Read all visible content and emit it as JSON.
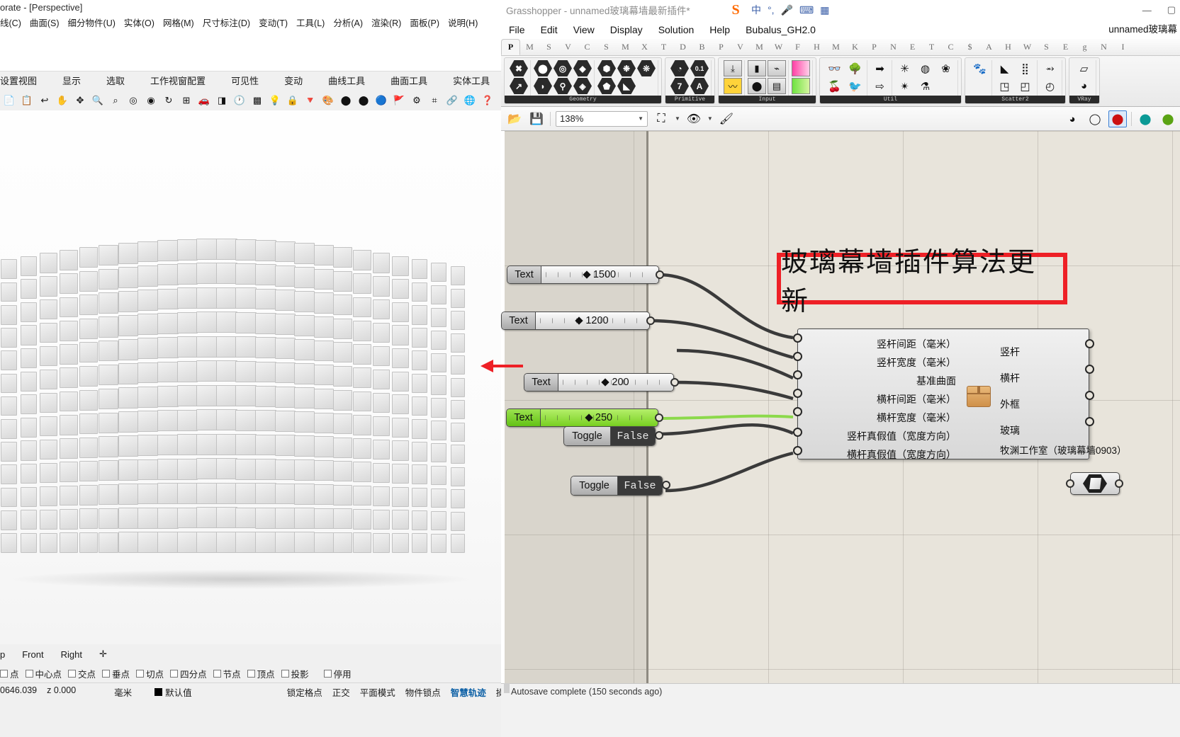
{
  "rhino": {
    "title": "orate - [Perspective]",
    "menus": [
      "线(C)",
      "曲面(S)",
      "细分物件(U)",
      "实体(O)",
      "网格(M)",
      "尺寸标注(D)",
      "变动(T)",
      "工具(L)",
      "分析(A)",
      "渲染(R)",
      "面板(P)",
      "说明(H)"
    ],
    "toolbar_tabs": [
      "设置视图",
      "显示",
      "选取",
      "工作视窗配置",
      "可见性",
      "变动",
      "曲线工具",
      "曲面工具",
      "实体工具"
    ],
    "icon_names": [
      "copy-icon",
      "paste-icon",
      "undo-icon",
      "pan-icon",
      "move-icon",
      "zoom-in-icon",
      "zoom-window-icon",
      "zoom-extents-icon",
      "zoom-selected-icon",
      "rotate-view-icon",
      "viewport-layout-icon",
      "car-icon",
      "shade-icon",
      "clock-icon",
      "properties-icon",
      "light-icon",
      "lock-icon",
      "color-icon",
      "colorwheel-icon",
      "sphere-grey-icon",
      "sphere-dark-icon",
      "sphere-blue-icon",
      "flag-icon",
      "gear-icon",
      "grid-icon",
      "link-icon",
      "globe-icon",
      "help-icon"
    ],
    "view_tabs": [
      "p",
      "Front",
      "Right"
    ],
    "osnaps": [
      "点",
      "中心点",
      "交点",
      "垂点",
      "切点",
      "四分点",
      "节点",
      "顶点",
      "投影",
      "停用"
    ],
    "status": {
      "coord_x": "0646.039",
      "coord_z": "z 0.000",
      "units": "毫米",
      "layer": "默认值",
      "toggles": [
        "锁定格点",
        "正交",
        "平面模式",
        "物件锁点",
        "智慧轨迹",
        "操作轴"
      ]
    }
  },
  "grasshopper": {
    "titlebar": {
      "title": "Grasshopper - unnamed玻璃幕墙最新插件*",
      "ime_icons": [
        "sogou-logo-icon",
        "chinese-mode-icon",
        "punctuation-icon",
        "microphone-icon",
        "keyboard-icon",
        "toolbox-icon"
      ],
      "ime_chinese": "中",
      "window_buttons": [
        "minimize-icon",
        "maximize-icon"
      ]
    },
    "menus": [
      "File",
      "Edit",
      "View",
      "Display",
      "Solution",
      "Help",
      "Bubalus_GH2.0"
    ],
    "document_label": "unnamed玻璃幕",
    "tabs": [
      "P",
      "M",
      "S",
      "V",
      "C",
      "S",
      "M",
      "X",
      "T",
      "D",
      "B",
      "P",
      "V",
      "M",
      "W",
      "F",
      "H",
      "M",
      "K",
      "P",
      "N",
      "E",
      "T",
      "C",
      "$",
      "A",
      "H",
      "W",
      "S",
      "E",
      "g",
      "N",
      "I"
    ],
    "active_tab_index": 0,
    "ribbon_groups": [
      {
        "name": "Geometry",
        "rows": [
          [
            "✖",
            "⬤",
            "◎",
            "◆",
            "⬢",
            "❉",
            "❊"
          ],
          [
            "↗",
            "◗",
            "⚲",
            "◈",
            "⬟",
            "◣"
          ]
        ]
      },
      {
        "name": "Primitive",
        "rows": [
          [
            "◔",
            "0.1"
          ],
          [
            "7",
            "A"
          ]
        ]
      },
      {
        "name": "Input",
        "rows": [
          [
            "⤓",
            "▮",
            "⌁",
            "▰"
          ],
          [
            "〰",
            "⬤",
            "▤",
            "▦"
          ]
        ]
      },
      {
        "name": "Util",
        "rows": [
          [
            "👓",
            "🌳",
            "➡",
            "✳",
            "◍",
            "❀"
          ],
          [
            "🍒",
            "🐦",
            "⇨",
            "✴",
            "⚗"
          ]
        ]
      },
      {
        "name": "Scatter2",
        "rows": [
          [
            "🐾",
            "◣",
            "⣿",
            "⥇"
          ],
          [
            "◳",
            "◰",
            "◴"
          ]
        ]
      },
      {
        "name": "VRay",
        "rows": [
          [
            "▱"
          ],
          [
            "◕"
          ]
        ]
      }
    ],
    "canvas_toolbar": {
      "open_icon": "open-folder-icon",
      "save_icon": "save-disk-icon",
      "zoom_value": "138%",
      "zoom_extents_icon": "zoom-extents-icon",
      "preview_icon": "eye-preview-icon",
      "bake_icon": "bake-icon",
      "display_modes": [
        "shaded-grey-icon",
        "wireframe-icon",
        "red-material-icon",
        "teal-material-icon",
        "green-material-icon"
      ],
      "selected_display_index": 2
    },
    "canvas": {
      "banner_text": "玻璃幕墙插件算法更新",
      "banner_color": "#ee2026",
      "sliders": [
        {
          "label": "Text",
          "value": "1500",
          "green": false
        },
        {
          "label": "Text",
          "value": "1200",
          "green": false
        },
        {
          "label": "Text",
          "value": "200",
          "green": false
        },
        {
          "label": "Text",
          "value": "250",
          "green": true
        }
      ],
      "toggles": [
        {
          "label": "Toggle",
          "state": "False"
        },
        {
          "label": "Toggle",
          "state": "False"
        }
      ],
      "surface_param": {
        "name": "surface-param-component",
        "icon": "surface-icon"
      },
      "cluster": {
        "inputs": [
          "竖杆间距（毫米）",
          "竖杆宽度（毫米）",
          "基准曲面",
          "横杆间距（毫米）",
          "横杆宽度（毫米）",
          "竖杆真假值（宽度方向）",
          "横杆真假值（宽度方向）"
        ],
        "outputs": [
          "竖杆",
          "横杆",
          "外框",
          "玻璃"
        ],
        "credit": "牧渊工作室（玻璃幕墙0903）",
        "icon": "cluster-box-icon"
      }
    },
    "statusbar": {
      "text": "Autosave complete (150 seconds ago)"
    }
  }
}
